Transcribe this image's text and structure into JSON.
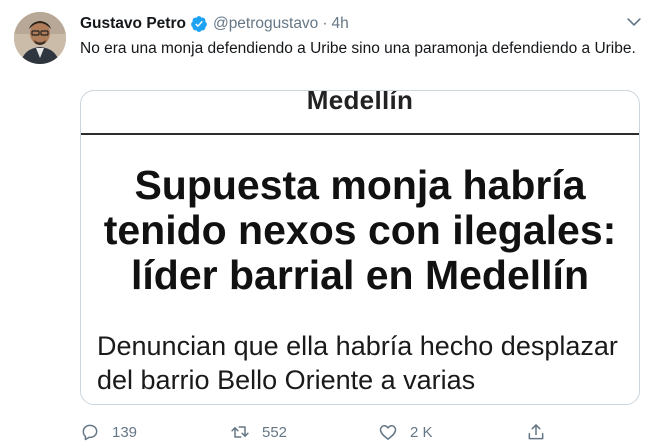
{
  "tweet": {
    "author_name": "Gustavo Petro",
    "author_handle": "@petrogustavo",
    "separator": "·",
    "timestamp": "4h",
    "text": "No era una monja defendiendo a Uribe sino una paramonja defendiendo a Uribe.",
    "verified": true
  },
  "card": {
    "section": "Medellín",
    "headline": "Supuesta monja habría tenido nexos con ilegales: líder barrial en Medellín",
    "summary": "Denuncian que ella habría hecho desplazar del barrio Bello Oriente a varias"
  },
  "actions": {
    "reply_count": "139",
    "retweet_count": "552",
    "like_count": "2 K"
  },
  "colors": {
    "verified": "#1da1f2",
    "muted": "#657786",
    "border": "#ccd6dd"
  },
  "icons": {
    "reply": "comment-icon",
    "retweet": "retweet-icon",
    "like": "heart-icon",
    "share": "share-icon",
    "more": "chevron-down-icon"
  }
}
